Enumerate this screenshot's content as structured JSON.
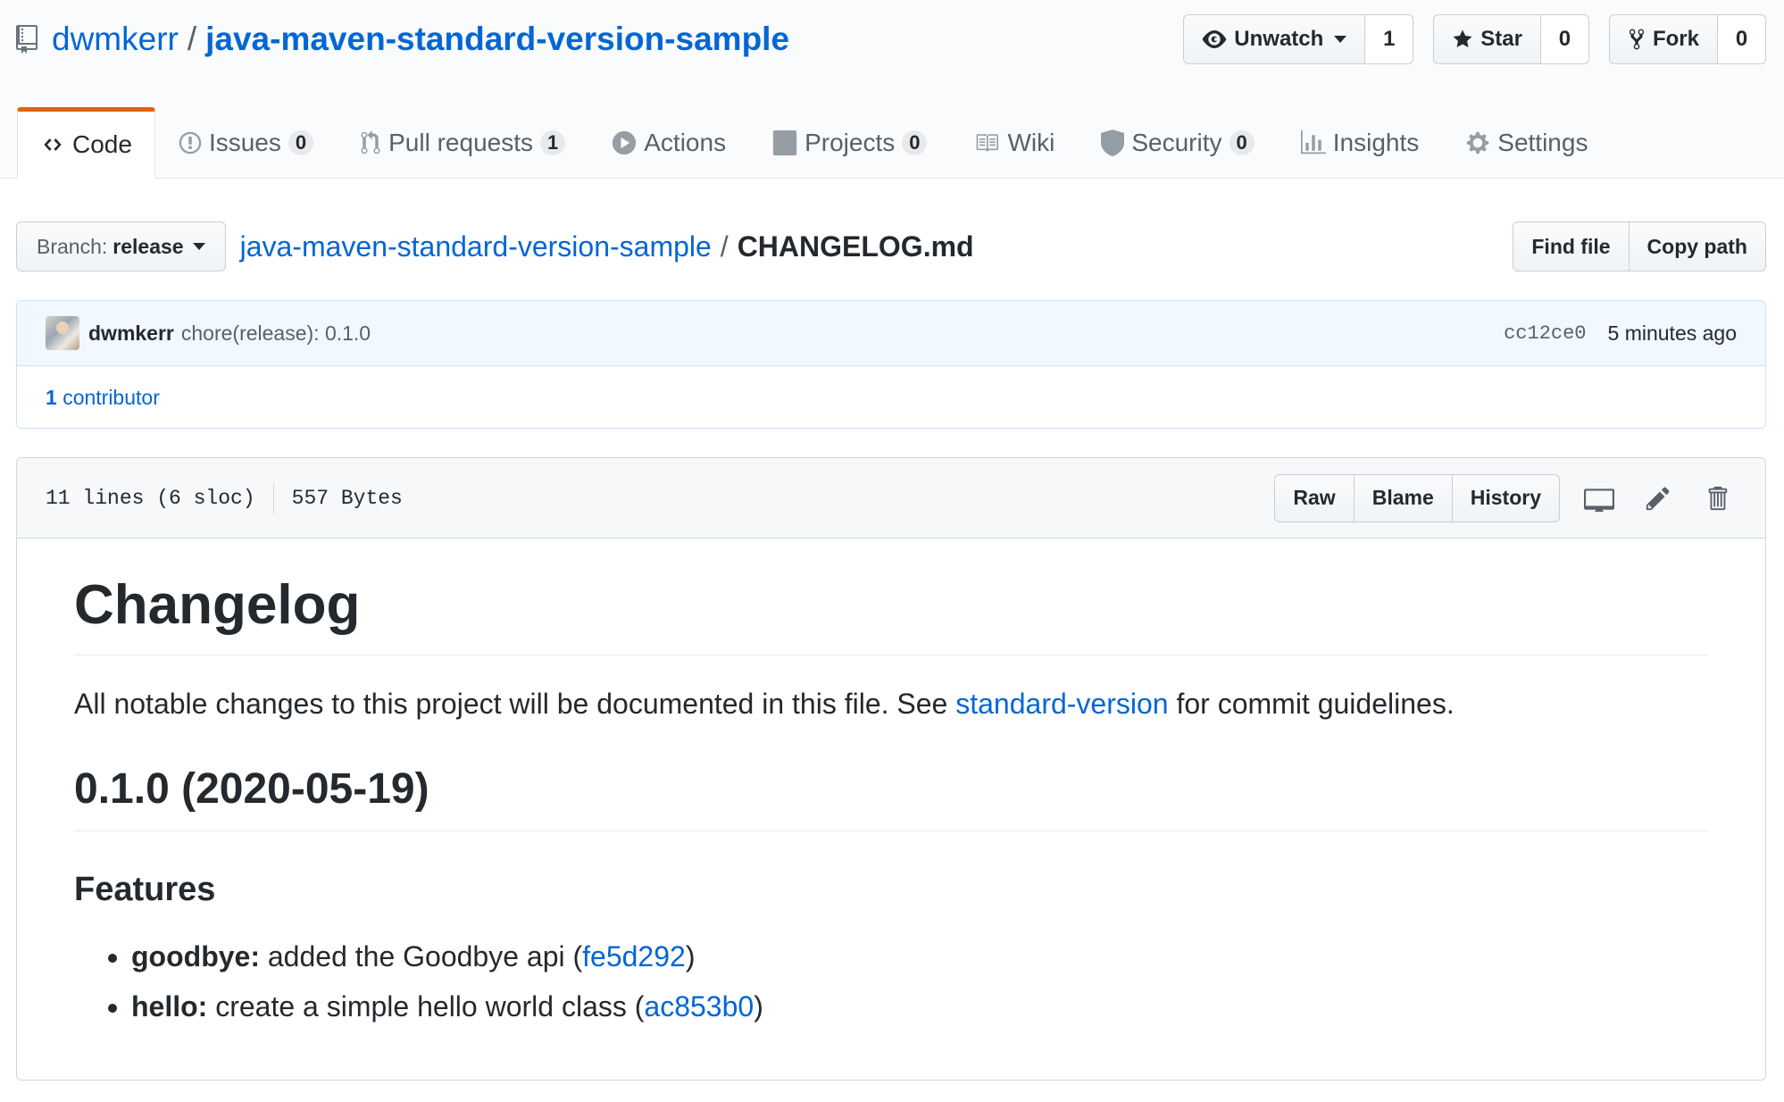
{
  "repo": {
    "owner": "dwmkerr",
    "separator": "/",
    "name": "java-maven-standard-version-sample"
  },
  "actions": {
    "watch": {
      "label": "Unwatch",
      "count": "1"
    },
    "star": {
      "label": "Star",
      "count": "0"
    },
    "fork": {
      "label": "Fork",
      "count": "0"
    }
  },
  "nav": {
    "code": "Code",
    "issues": {
      "label": "Issues",
      "count": "0"
    },
    "pulls": {
      "label": "Pull requests",
      "count": "1"
    },
    "actions": "Actions",
    "projects": {
      "label": "Projects",
      "count": "0"
    },
    "wiki": "Wiki",
    "security": {
      "label": "Security",
      "count": "0"
    },
    "insights": "Insights",
    "settings": "Settings"
  },
  "file_nav": {
    "branch_label": "Branch:",
    "branch_value": "release",
    "breadcrumb_repo": "java-maven-standard-version-sample",
    "breadcrumb_sep": "/",
    "breadcrumb_file": "CHANGELOG.md",
    "find_file": "Find file",
    "copy_path": "Copy path"
  },
  "commit": {
    "author": "dwmkerr",
    "message": "chore(release): 0.1.0",
    "sha": "cc12ce0",
    "time": "5 minutes ago",
    "contributor_count": "1",
    "contributor_label": "contributor"
  },
  "file": {
    "lines": "11 lines (6 sloc)",
    "size": "557 Bytes",
    "raw": "Raw",
    "blame": "Blame",
    "history": "History"
  },
  "markdown": {
    "h1": "Changelog",
    "intro_before": "All notable changes to this project will be documented in this file. See ",
    "intro_link": "standard-version",
    "intro_after": " for commit guidelines.",
    "h2": "0.1.0 (2020-05-19)",
    "h3": "Features",
    "items": [
      {
        "scope": "goodbye:",
        "text": " added the Goodbye api (",
        "link": "fe5d292",
        "close": ")"
      },
      {
        "scope": "hello:",
        "text": " create a simple hello world class (",
        "link": "ac853b0",
        "close": ")"
      }
    ]
  },
  "colors": {
    "link": "#0366d6",
    "tab_accent": "#e36209",
    "commit_bg": "#f1f8ff"
  }
}
